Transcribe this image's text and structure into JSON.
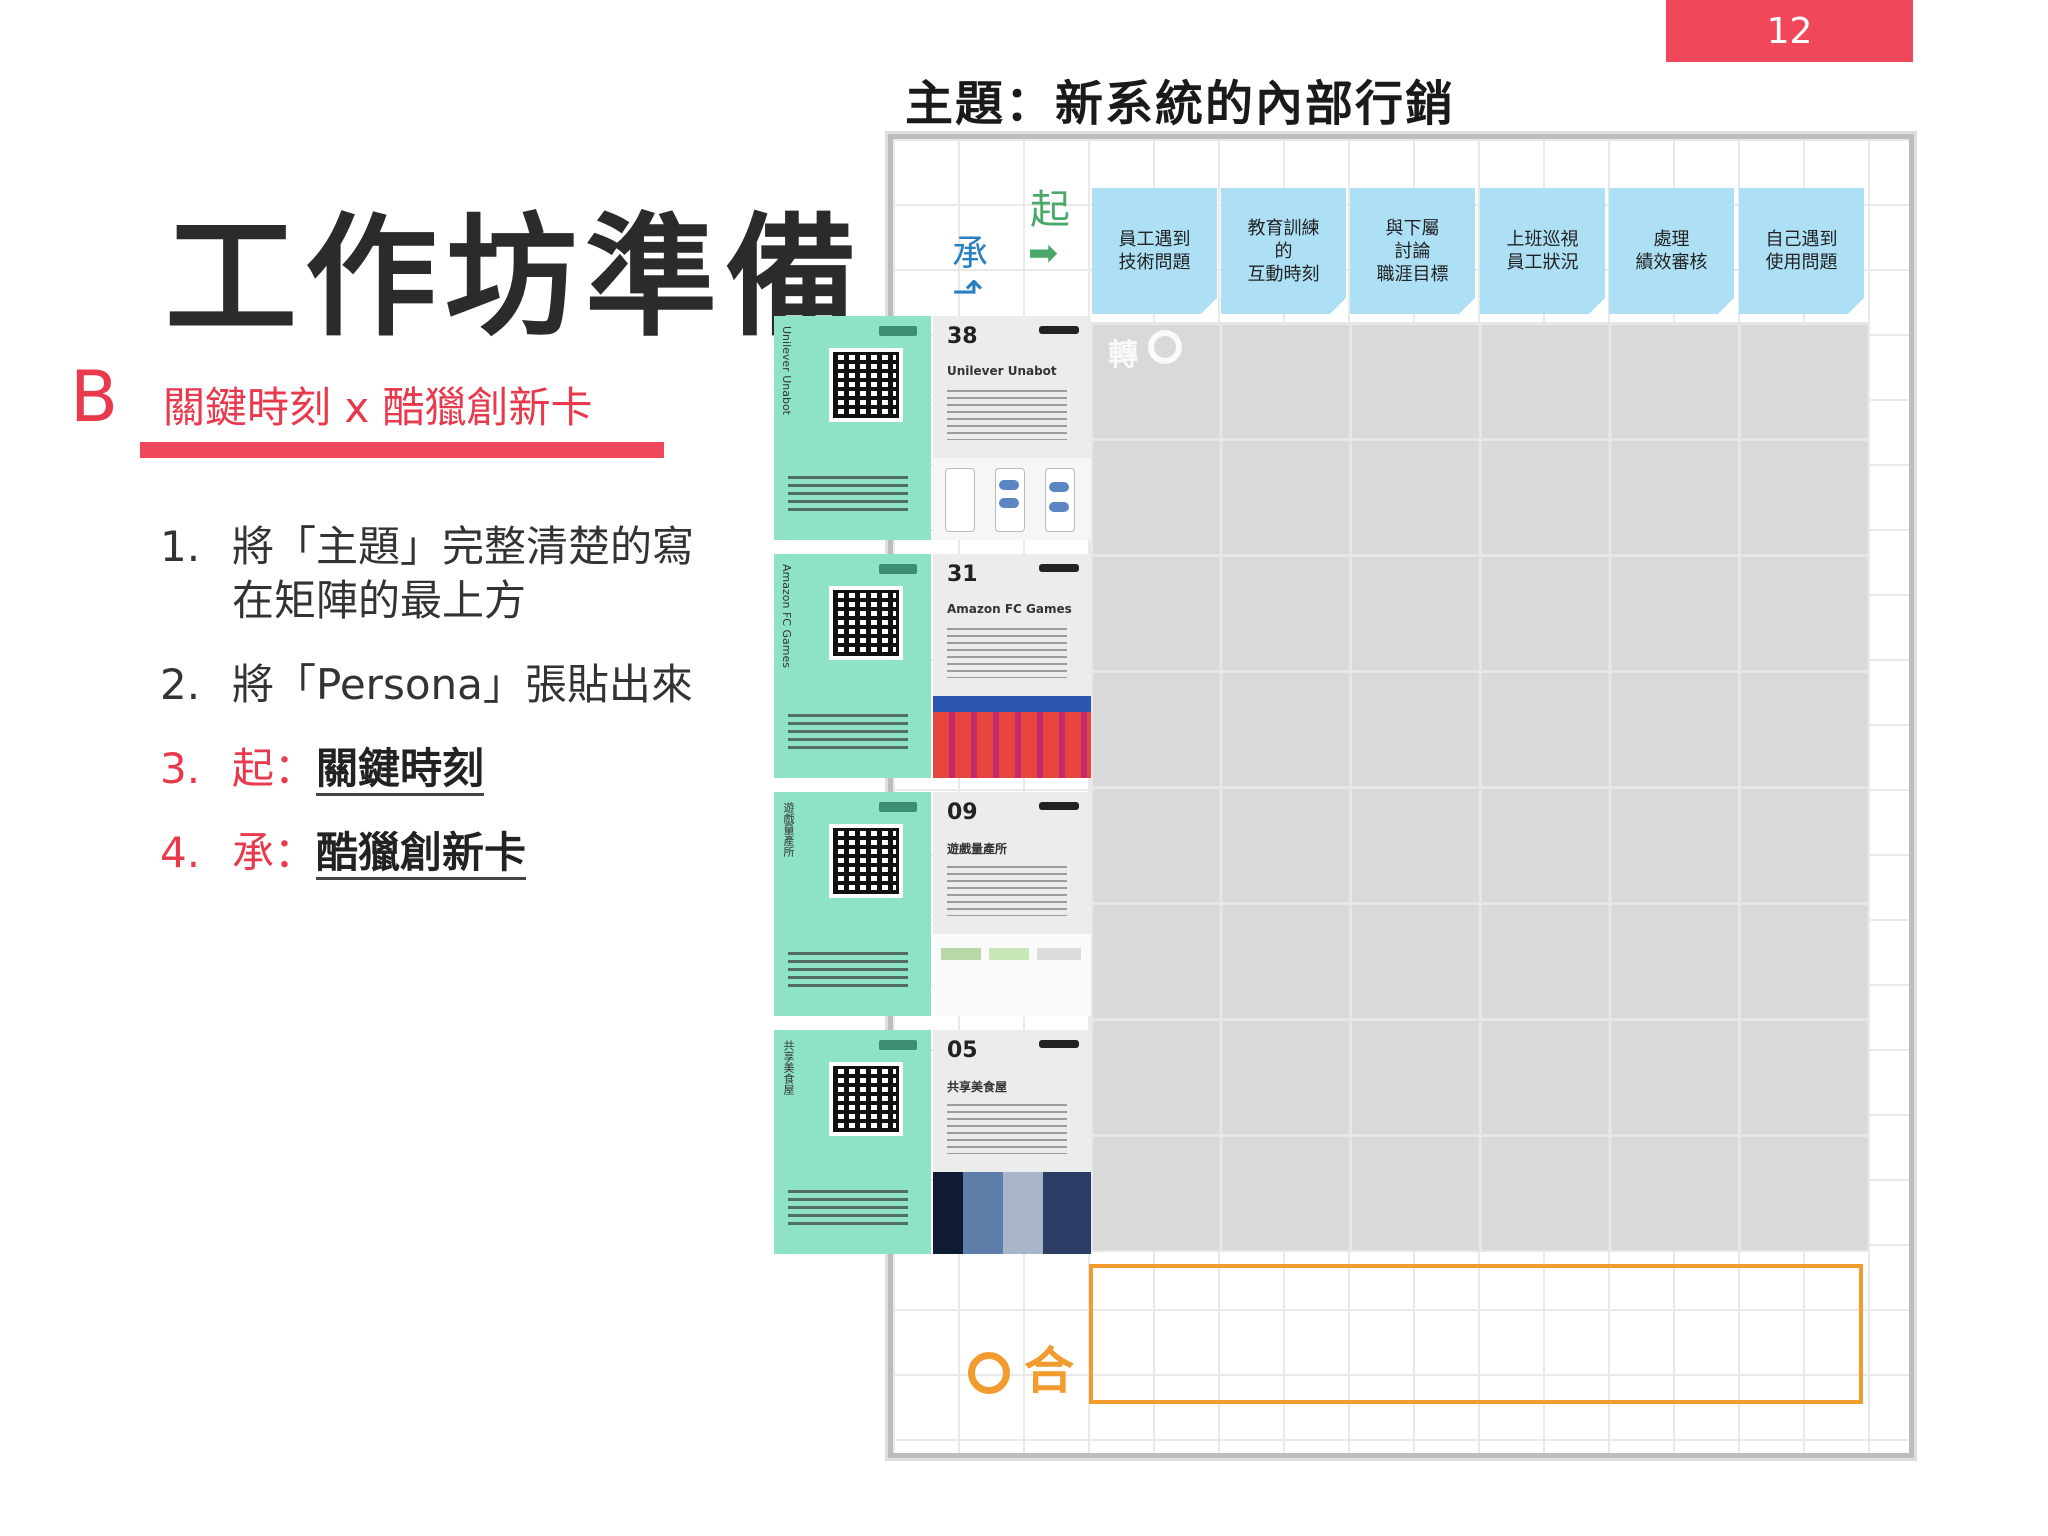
{
  "page_number": "12",
  "theme_title": "主題：新系統的內部行銷",
  "main_title": "工作坊準備",
  "section": {
    "letter": "B",
    "subtitle": "關鍵時刻 x 酷獵創新卡"
  },
  "steps": [
    {
      "num": "1.",
      "text": "將「主題」完整清楚的寫\n在矩陣的最上方"
    },
    {
      "num": "2.",
      "text": "將「Persona」張貼出來"
    },
    {
      "num": "3.",
      "prefix": "起：",
      "link": "關鍵時刻"
    },
    {
      "num": "4.",
      "prefix": "承：",
      "link": "酷獵創新卡"
    }
  ],
  "board": {
    "qi_label": "起",
    "cheng_label": "承",
    "he_label": "合",
    "column_headers": [
      "員工遇到\n技術問題",
      "教育訓練\n的\n互動時刻",
      "與下屬\n討論\n職涯目標",
      "上班巡視\n員工狀況",
      "處理\n績效審核",
      "自己遇到\n使用問題"
    ],
    "cards": [
      {
        "number": "38",
        "name": "Unilever Unabot",
        "side_label": "Unilever Unabot"
      },
      {
        "number": "31",
        "name": "Amazon FC Games",
        "side_label": "Amazon FC Games"
      },
      {
        "number": "09",
        "name": "遊戲量產所",
        "side_label": "遊戲量產所"
      },
      {
        "number": "05",
        "name": "共享美食屋",
        "side_label": "共享美食屋"
      }
    ],
    "faded_mark": "轉"
  },
  "colors": {
    "accent_red": "#f0475a",
    "header_blue": "#aee0f5",
    "card_green": "#8ee2c6",
    "he_orange": "#f29b2e",
    "qi_green": "#4aa86b",
    "cheng_blue": "#2a7fc1"
  }
}
